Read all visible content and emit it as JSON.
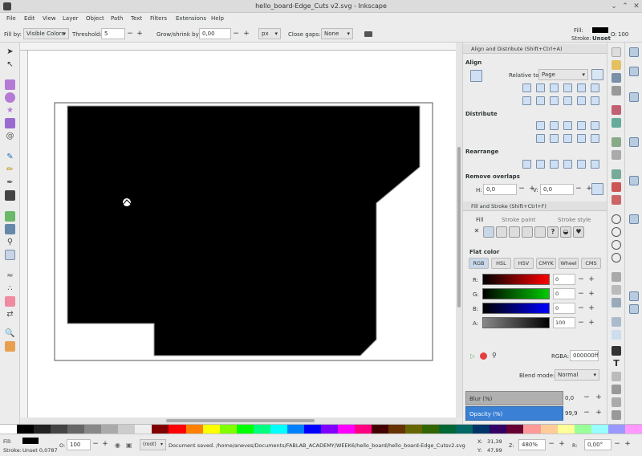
{
  "window": {
    "title": "hello_board-Edge_Cuts v2.svg - Inkscape"
  },
  "menu": [
    "File",
    "Edit",
    "View",
    "Layer",
    "Object",
    "Path",
    "Text",
    "Filters",
    "Extensions",
    "Help"
  ],
  "tool_controls": {
    "fill_by_label": "Fill by:",
    "fill_by_value": "Visible Colors",
    "threshold_label": "Threshold:",
    "threshold_value": "5",
    "grow_label": "Grow/shrink by:",
    "grow_value": "0,00",
    "unit": "px",
    "close_gaps_label": "Close gaps:",
    "close_gaps_value": "None"
  },
  "style_indicator": {
    "fill_label": "Fill:",
    "stroke_label": "Stroke:",
    "stroke_value": "Unset",
    "opacity_label": "O:",
    "opacity_value": "100"
  },
  "align_panel": {
    "title": "Align and Distribute (Shift+Ctrl+A)",
    "align_label": "Align",
    "relative_label": "Relative to:",
    "relative_value": "Page",
    "distribute_label": "Distribute",
    "rearrange_label": "Rearrange",
    "overlaps_label": "Remove overlaps",
    "h_label": "H:",
    "h_value": "0,0",
    "v_label": "V:",
    "v_value": "0,0"
  },
  "fill_panel": {
    "title": "Fill and Stroke (Shift+Ctrl+F)",
    "tabs": [
      "Fill",
      "Stroke paint",
      "Stroke style"
    ],
    "flat_color_label": "Flat color",
    "color_modes": [
      "RGB",
      "HSL",
      "HSV",
      "CMYK",
      "Wheel",
      "CMS"
    ],
    "channels": [
      {
        "label": "R:",
        "value": "0"
      },
      {
        "label": "G:",
        "value": "0"
      },
      {
        "label": "B:",
        "value": "0"
      },
      {
        "label": "A:",
        "value": "100"
      }
    ],
    "rgba_label": "RGBA:",
    "rgba_value": "000000ff",
    "blend_label": "Blend mode:",
    "blend_value": "Normal",
    "blur_label": "Blur (%)",
    "blur_value": "0,0",
    "opacity_label": "Opacity (%)",
    "opacity_value": "99,9"
  },
  "status": {
    "fill_label": "Fill:",
    "stroke_label": "Stroke:",
    "stroke_value": "Unset 0,0787",
    "opacity_label": "O:",
    "opacity_value": "100",
    "layer": "(root)",
    "message": "Document saved. /home/aneves/Documents/FABLAB_ACADEMY/WEEK6/hello_board/hello_board-Edge_Cutsv2.svg",
    "x_label": "X:",
    "x_value": "31,39",
    "y_label": "Y:",
    "y_value": "47,99",
    "zoom_label": "Z:",
    "zoom_value": "480%",
    "rotate_label": "R:",
    "rotate_value": "0,00°"
  },
  "colors": {
    "accent": "#3a80d4",
    "canvas": "#ffffff",
    "shape": "#000000"
  }
}
